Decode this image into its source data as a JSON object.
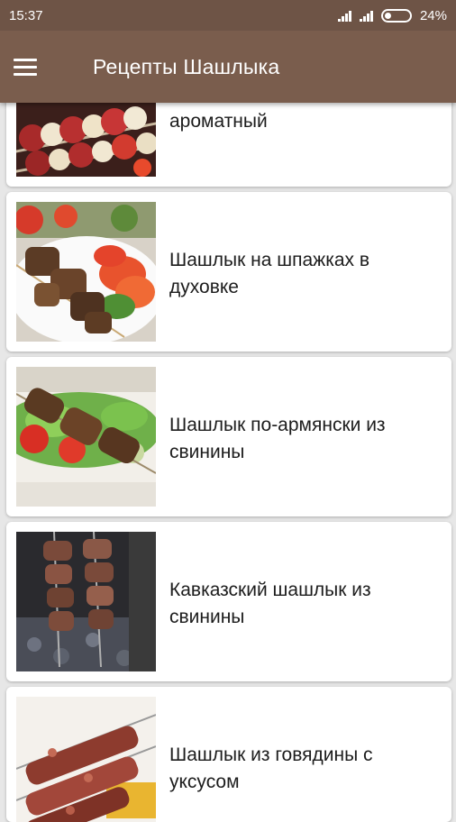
{
  "status": {
    "time": "15:37",
    "battery": "24%"
  },
  "appbar": {
    "menu_icon": "hamburger-menu-icon",
    "title": "Рецепты Шашлыка"
  },
  "recipes": [
    {
      "title": "Шашлык из свиной шеи ароматный",
      "image": "pork-and-onion-skewers"
    },
    {
      "title": "Шашлык на шпажках в духовке",
      "image": "oven-skewers-with-tomatoes"
    },
    {
      "title": "Шашлык по-армянски из свинины",
      "image": "armenian-pork-kebab-with-salad"
    },
    {
      "title": "Кавказский шашлык из свинины",
      "image": "caucasian-skewers-over-coals"
    },
    {
      "title": "Шашлык из говядины с уксусом",
      "image": "beef-skewers-on-grill"
    }
  ]
}
